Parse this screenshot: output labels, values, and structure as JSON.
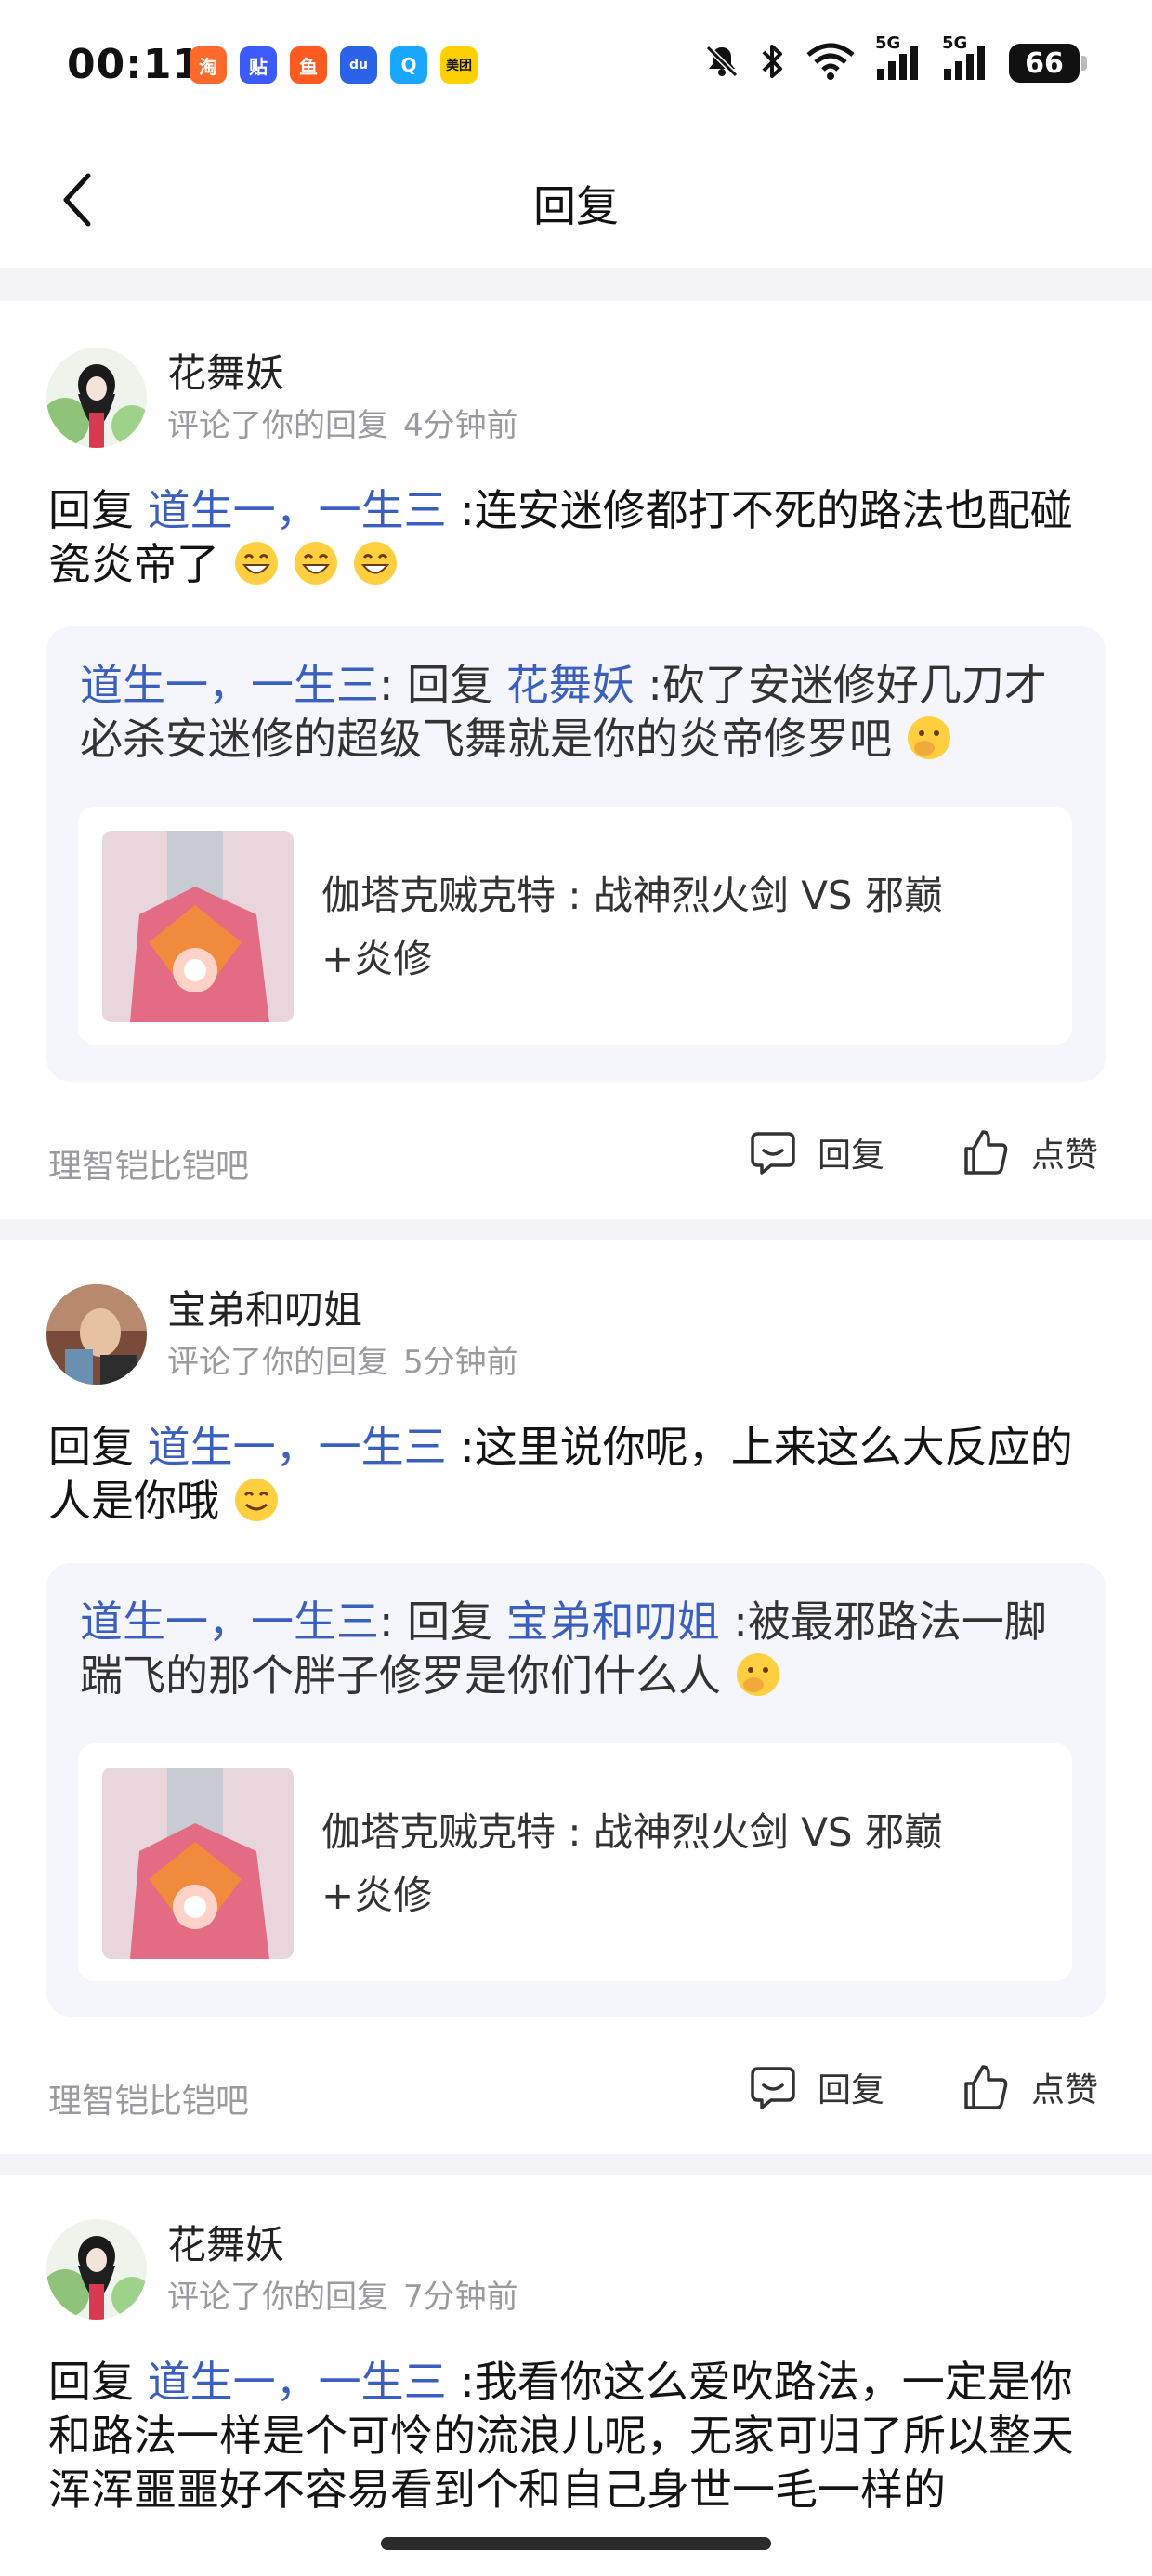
{
  "status_bar": {
    "time": "00:11",
    "app_icons": [
      {
        "name": "taobao-icon",
        "glyph": "淘",
        "color": "#ff6a2c"
      },
      {
        "name": "tieba-icon",
        "glyph": "贴",
        "color": "#3d5afe"
      },
      {
        "name": "xianyu-icon",
        "glyph": "鱼",
        "color": "#ff5a1f"
      },
      {
        "name": "baidu-icon",
        "glyph": "du",
        "color": "#2b63e8"
      },
      {
        "name": "qq-icon",
        "glyph": "Q",
        "color": "#18a6ff"
      },
      {
        "name": "meituan-icon",
        "glyph": "美团",
        "color": "#ffd000"
      }
    ],
    "signal_1_label": "5G",
    "signal_2_label": "5G",
    "battery": "66"
  },
  "header": {
    "title": "回复"
  },
  "cards": [
    {
      "user": "花舞妖",
      "action": "评论了你的回复",
      "time": "4分钟前",
      "reply_prefix": "回复",
      "reply_target": "道生一，一生三",
      "reply_text": ":连安迷修都打不死的路法也配碰瓷炎帝了",
      "quote_author": "道生一，一生三",
      "quote_sep": ":",
      "quote_prefix": "回复",
      "quote_target": "花舞妖",
      "quote_text": ":砍了安迷修好几刀才必杀安迷修的超级飞舞就是你的炎帝修罗吧",
      "post_title_line1": "伽塔克贼克特 : 战神烈火剑 VS 邪巅",
      "post_title_line2": "+炎修",
      "forum": "理智铠比铠吧",
      "reply_label": "回复",
      "like_label": "点赞"
    },
    {
      "user": "宝弟和叨姐",
      "action": "评论了你的回复",
      "time": "5分钟前",
      "reply_prefix": "回复",
      "reply_target": "道生一，一生三",
      "reply_text": ":这里说你呢，上来这么大反应的人是你哦",
      "quote_author": "道生一，一生三",
      "quote_sep": ":",
      "quote_prefix": "回复",
      "quote_target": "宝弟和叨姐",
      "quote_text": ":被最邪路法一脚踹飞的那个胖子修罗是你们什么人",
      "post_title_line1": "伽塔克贼克特 : 战神烈火剑 VS 邪巅",
      "post_title_line2": "+炎修",
      "forum": "理智铠比铠吧",
      "reply_label": "回复",
      "like_label": "点赞"
    },
    {
      "user": "花舞妖",
      "action": "评论了你的回复",
      "time": "7分钟前",
      "reply_prefix": "回复",
      "reply_target": "道生一，一生三",
      "reply_text": ":我看你这么爱吹路法，一定是你和路法一样是个可怜的流浪儿呢，无家可归了所以整天浑浑噩噩好不容易看到个和自己身世一毛一样的"
    }
  ]
}
